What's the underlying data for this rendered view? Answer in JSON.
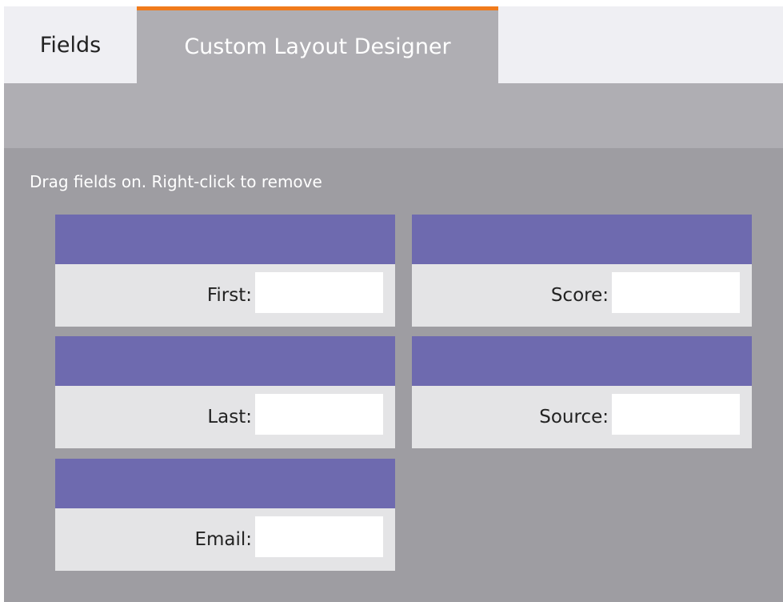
{
  "tabs": {
    "fields_label": "Fields",
    "designer_label": "Custom Layout Designer"
  },
  "canvas": {
    "hint": "Drag fields on. Right-click to remove"
  },
  "fields": {
    "first": {
      "label": "First:",
      "value": ""
    },
    "last": {
      "label": "Last:",
      "value": ""
    },
    "email": {
      "label": "Email:",
      "value": ""
    },
    "score": {
      "label": "Score:",
      "value": ""
    },
    "source": {
      "label": "Source:",
      "value": ""
    }
  },
  "colors": {
    "accent": "#f07b1c",
    "field_header": "#6e6aaf",
    "field_body": "#e4e4e6",
    "canvas": "#9e9da2",
    "toolbar": "#afaeb3"
  }
}
